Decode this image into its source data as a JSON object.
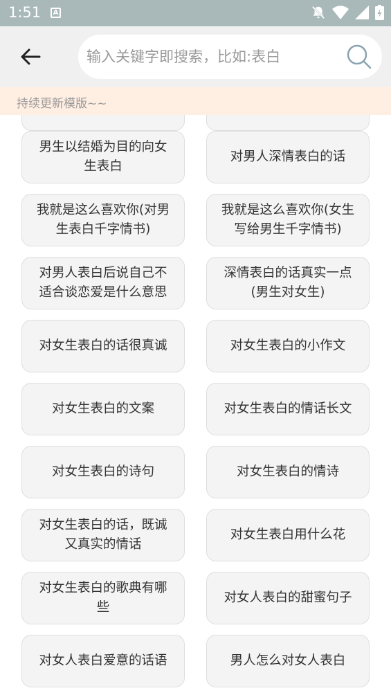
{
  "status_bar": {
    "time": "1:51",
    "notification_badge": "A"
  },
  "search": {
    "placeholder": "输入关键字即搜索，比如:表白"
  },
  "notice": {
    "text": "持续更新模版~~"
  },
  "items": [
    {
      "left": "",
      "right": ""
    },
    {
      "left": "男生以结婚为目的向女生表白",
      "right": "对男人深情表白的话"
    },
    {
      "left": "我就是这么喜欢你(对男生表白千字情书)",
      "right": "我就是这么喜欢你(女生写给男生千字情书)"
    },
    {
      "left": "对男人表白后说自己不适合谈恋爱是什么意思",
      "right": "深情表白的话真实一点(男生对女生)"
    },
    {
      "left": "对女生表白的话很真诚",
      "right": "对女生表白的小作文"
    },
    {
      "left": "对女生表白的文案",
      "right": "对女生表白的情话长文"
    },
    {
      "left": "对女生表白的诗句",
      "right": "对女生表白的情诗"
    },
    {
      "left": "对女生表白的话，既诚又真实的情话",
      "right": "对女生表白用什么花"
    },
    {
      "left": "对女生表白的歌典有哪些",
      "right": "对女人表白的甜蜜句子"
    },
    {
      "left": "对女人表白爱意的话语",
      "right": "男人怎么对女人表白"
    }
  ],
  "colors": {
    "status_bar": "#a9b9b9",
    "header": "#f0f0f0",
    "notice_bg": "#ffeee2",
    "cell_bg": "#f4f4f4",
    "cell_border": "#dedede"
  }
}
